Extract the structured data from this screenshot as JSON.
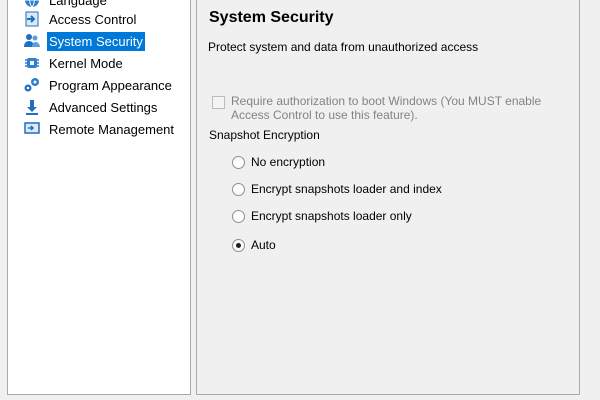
{
  "sidebar": {
    "items": [
      {
        "label": "Language",
        "icon": "globe-icon",
        "selected": false
      },
      {
        "label": "Access Control",
        "icon": "door-arrow-icon",
        "selected": false
      },
      {
        "label": "System Security",
        "icon": "users-icon",
        "selected": true
      },
      {
        "label": "Kernel Mode",
        "icon": "chip-icon",
        "selected": false
      },
      {
        "label": "Program Appearance",
        "icon": "gears-icon",
        "selected": false
      },
      {
        "label": "Advanced Settings",
        "icon": "download-arrow-icon",
        "selected": false
      },
      {
        "label": "Remote Management",
        "icon": "monitor-icon",
        "selected": false
      }
    ]
  },
  "panel": {
    "title": "System Security",
    "description": "Protect system and data from unauthorized access",
    "require_auth": {
      "label": "Require authorization to boot Windows (You MUST enable Access Control to use this feature).",
      "checked": false,
      "enabled": false
    },
    "snapshot_encryption": {
      "label": "Snapshot Encryption",
      "options": [
        {
          "label": "No encryption",
          "checked": false
        },
        {
          "label": "Encrypt snapshots loader and index",
          "checked": false
        },
        {
          "label": "Encrypt snapshots loader only",
          "checked": false
        },
        {
          "label": "Auto",
          "checked": true
        }
      ]
    }
  },
  "colors": {
    "selection": "#0078d7",
    "disabled_text": "#838383",
    "icon_blue": "#1e6fc4"
  }
}
